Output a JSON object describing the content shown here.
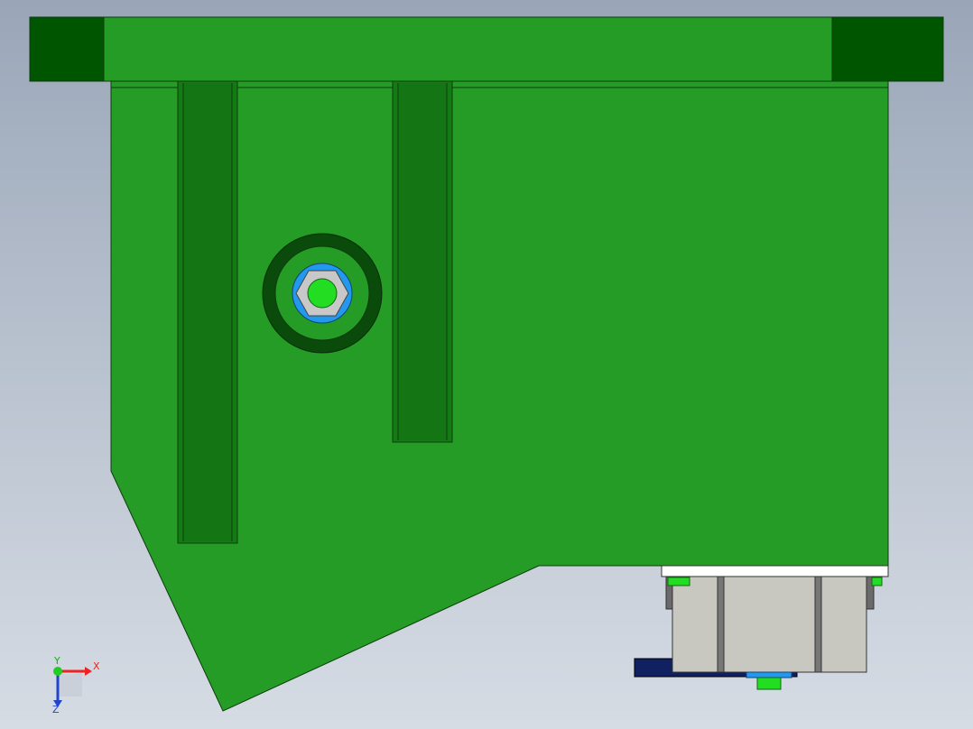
{
  "colors": {
    "part_green": "#259c25",
    "plate_dark_green": "#005500",
    "slot_green": "#147a14",
    "washer_blue": "#2299ee",
    "bolt_green": "#22dd22",
    "nut_gray": "#c8c8c8",
    "block_gray": "#c8c8c0",
    "base_navy": "#102060",
    "axis_x": "#ee2222",
    "axis_y": "#22cc22",
    "axis_z": "#2244cc"
  },
  "triad": {
    "x_label": "X",
    "y_label": "Y",
    "z_label": "Z"
  }
}
